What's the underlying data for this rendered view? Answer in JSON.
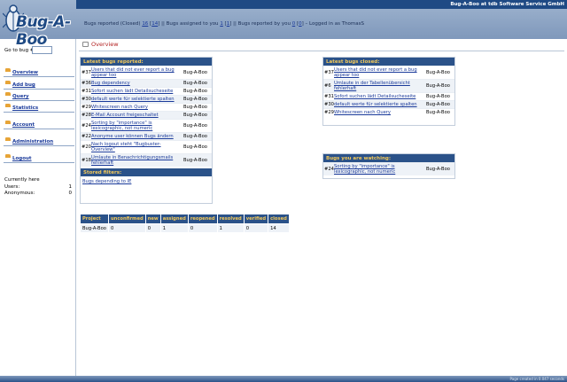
{
  "header": {
    "logo_text": "Bug-A-Boo",
    "company": "Bug-A-Boo at tdb Software Service GmbH",
    "status": {
      "closed_label": "Bugs reported (Closed)",
      "closed_count": "16",
      "closed_total": "14",
      "assigned_label": "Bugs assigned to you",
      "assigned_count": "1",
      "assigned_total": "1",
      "reported_label": "Bugs reported by you",
      "reported_count": "0",
      "reported_total": "0",
      "logged_in": "Logged in as ThomasS"
    }
  },
  "sidebar": {
    "goto_label": "Go to bug #",
    "goto_value": "",
    "items": [
      {
        "label": "Overview"
      },
      {
        "label": "Add bug"
      },
      {
        "label": "Query"
      },
      {
        "label": "Statistics"
      },
      {
        "label": "Account"
      },
      {
        "label": "Administration"
      },
      {
        "label": "Logout"
      }
    ],
    "currently": {
      "heading": "Currently here",
      "users_label": "Users:",
      "users_value": "1",
      "anon_label": "Anonymous:",
      "anon_value": "0"
    }
  },
  "main": {
    "title": "Overview",
    "reported": {
      "heading": "Latest bugs reported:",
      "rows": [
        {
          "num": "#37",
          "title": "Users that did not ever report a bug appear too",
          "project": "Bug-A-Boo"
        },
        {
          "num": "#36",
          "title": "Bug dependency",
          "project": "Bug-A-Boo"
        },
        {
          "num": "#31",
          "title": "Sofort suchen lädt Detailsucheseite",
          "project": "Bug-A-Boo"
        },
        {
          "num": "#30",
          "title": "default werte für selektierte spalten",
          "project": "Bug-A-Boo"
        },
        {
          "num": "#29",
          "title": "Whitescreen nach Query",
          "project": "Bug-A-Boo"
        },
        {
          "num": "#28",
          "title": "E-Mail Account freigeschaltet",
          "project": "Bug-A-Boo"
        },
        {
          "num": "#24",
          "title": "Sorting by \"importance\" is lexicographic, not numeric",
          "project": "Bug-A-Boo"
        },
        {
          "num": "#22",
          "title": "Anonyme user können Bugs ändern",
          "project": "Bug-A-Boo"
        },
        {
          "num": "#20",
          "title": "Nach logout steht \"Bugbuster-Overview\"",
          "project": "Bug-A-Boo"
        },
        {
          "num": "#18",
          "title": "Umlaute in Benachrichtigungsmails fehlerhaft",
          "project": "Bug-A-Boo"
        }
      ],
      "stored_heading": "Stored filters:",
      "stored_link": "Bugs depending to IE"
    },
    "closed": {
      "heading": "Latest bugs closed:",
      "rows": [
        {
          "num": "#37",
          "title": "Users that did not ever report a bug appear too",
          "project": "Bug-A-Boo"
        },
        {
          "num": "#6",
          "title": "Umlaute in der Tabellenübersicht fehlerhaft",
          "project": "Bug-A-Boo"
        },
        {
          "num": "#31",
          "title": "Sofort suchen lädt Detailsucheseite",
          "project": "Bug-A-Boo"
        },
        {
          "num": "#30",
          "title": "default werte für selektierte spalten",
          "project": "Bug-A-Boo"
        },
        {
          "num": "#29",
          "title": "Whitescreen nach Query",
          "project": "Bug-A-Boo"
        }
      ]
    },
    "watching": {
      "heading": "Bugs you are watching:",
      "rows": [
        {
          "num": "#24",
          "title": "Sorting by \"importance\" is lexicographic, not numeric",
          "project": "Bug-A-Boo"
        }
      ]
    },
    "stats": {
      "headers": [
        "Project",
        "unconfirmed",
        "new",
        "assigned",
        "reopened",
        "resolved",
        "verified",
        "closed"
      ],
      "rows": [
        [
          "Bug-A-Boo",
          "0",
          "0",
          "1",
          "0",
          "1",
          "0",
          "14"
        ]
      ]
    }
  },
  "footer": {
    "text": "Page created in 0.047 seconds"
  },
  "colors": {
    "accent": "#2b5289",
    "heading_text": "#f3c95a",
    "link": "#1a3a9a",
    "title_red": "#b32222"
  }
}
